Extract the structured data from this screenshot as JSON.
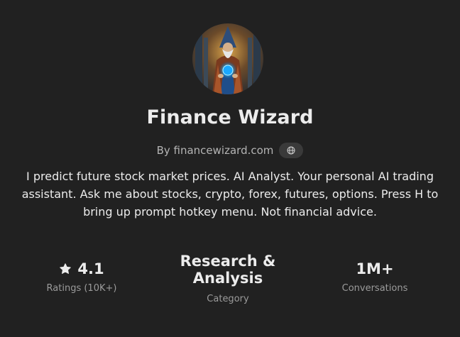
{
  "gpt": {
    "name": "Finance Wizard",
    "byline": "By financewizard.com",
    "description": "I predict future stock market prices. AI Analyst. Your personal AI trading assistant. Ask me about stocks, crypto, forex, futures, options. Press H to bring up prompt hotkey menu. Not financial advice.",
    "avatar_icon": "wizard-avatar",
    "website_icon": "globe-icon"
  },
  "stats": {
    "rating": {
      "value": "4.1",
      "label": "Ratings (10K+)",
      "icon": "star-icon"
    },
    "category": {
      "value": "Research & Analysis",
      "label": "Category"
    },
    "conversations": {
      "value": "1M+",
      "label": "Conversations"
    }
  },
  "colors": {
    "background": "#212121",
    "text_primary": "#ececec",
    "text_secondary": "#9b9b9b",
    "pill_background": "#3a3a3a"
  }
}
